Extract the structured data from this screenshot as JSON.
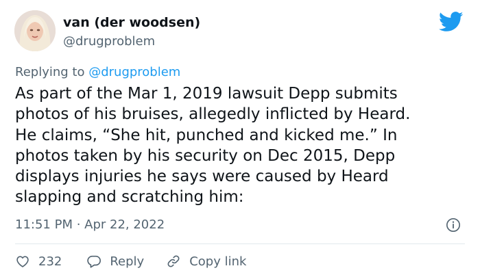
{
  "author": {
    "display_name": "van (der woodsen)",
    "handle": "@drugproblem"
  },
  "replying": {
    "prefix": "Replying to ",
    "mention": "@drugproblem"
  },
  "tweet": {
    "lines": [
      "As part of the Mar 1, 2019 lawsuit Depp submits",
      "photos of his bruises, allegedly inflicted by Heard.",
      "He claims, “She hit, punched and kicked me.” In",
      "photos taken by his security on Dec 2015, Depp",
      "displays injuries he says were caused by Heard",
      "slapping and scratching him:"
    ]
  },
  "timestamp": "11:51 PM · Apr 22, 2022",
  "actions": {
    "like_count": "232",
    "reply_label": "Reply",
    "copy_link_label": "Copy link"
  },
  "icons": {
    "brand": "twitter-bird-icon",
    "info": "info-icon",
    "like": "heart-icon",
    "reply": "reply-bubble-icon",
    "link": "link-icon"
  },
  "colors": {
    "brand_blue": "#1d9bf0",
    "text_primary": "#0f1419",
    "text_secondary": "#536471",
    "divider": "#e1e8ed"
  }
}
